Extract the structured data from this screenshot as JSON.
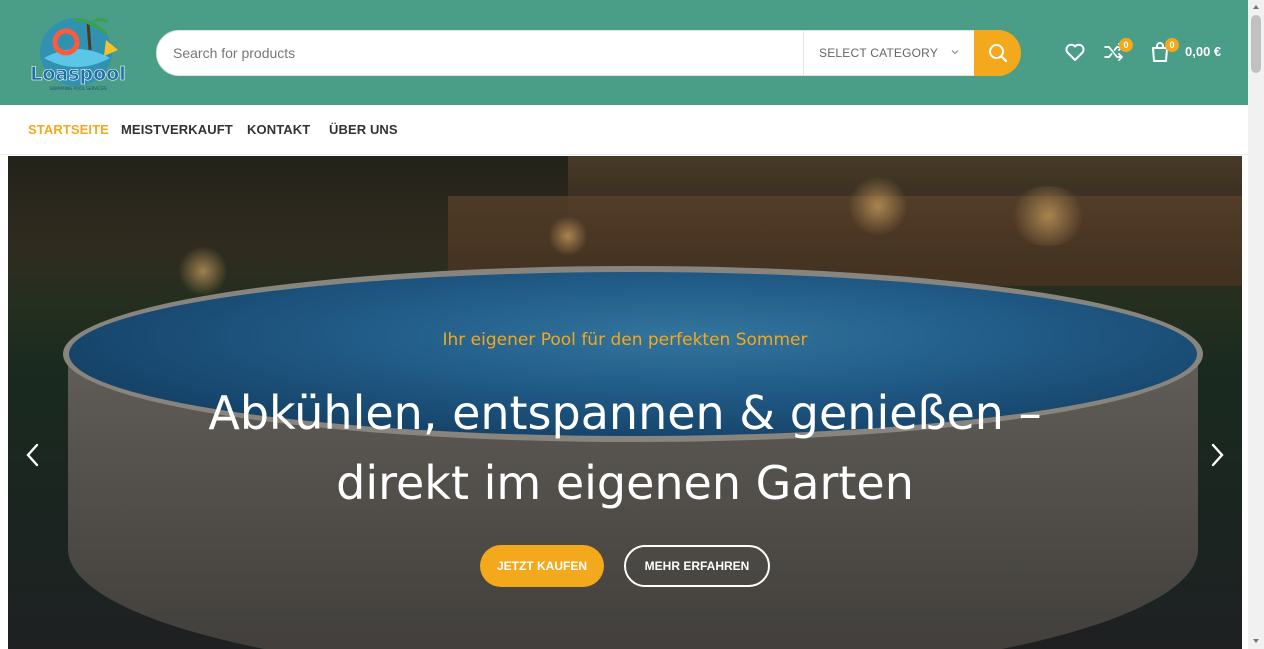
{
  "header": {
    "logo": {
      "text": "Loaspool",
      "tagline": "SWIMMING POOL SERVICES"
    },
    "search": {
      "placeholder": "Search for products",
      "category_label": "SELECT CATEGORY"
    },
    "wishlist_icon": "heart-icon",
    "compare": {
      "icon": "shuffle-icon",
      "count": "0"
    },
    "cart": {
      "icon": "shopping-bag-icon",
      "count": "0",
      "total": "0,00 €"
    }
  },
  "nav": {
    "items": [
      {
        "label": "STARTSEITE",
        "active": true
      },
      {
        "label": "MEISTVERKAUFT",
        "active": false
      },
      {
        "label": "KONTAKT",
        "active": false
      },
      {
        "label": "ÜBER UNS",
        "active": false
      }
    ]
  },
  "hero": {
    "subtitle": "Ihr eigener Pool für den perfekten Sommer",
    "title_line1": "Abkühlen, entspannen & genießen –",
    "title_line2": "direkt im eigenen Garten",
    "primary_button": "JETZT KAUFEN",
    "secondary_button": "MEHR ERFAHREN"
  },
  "colors": {
    "header_bg": "#4a9e88",
    "accent": "#f4a81c",
    "nav_text": "#333333"
  }
}
